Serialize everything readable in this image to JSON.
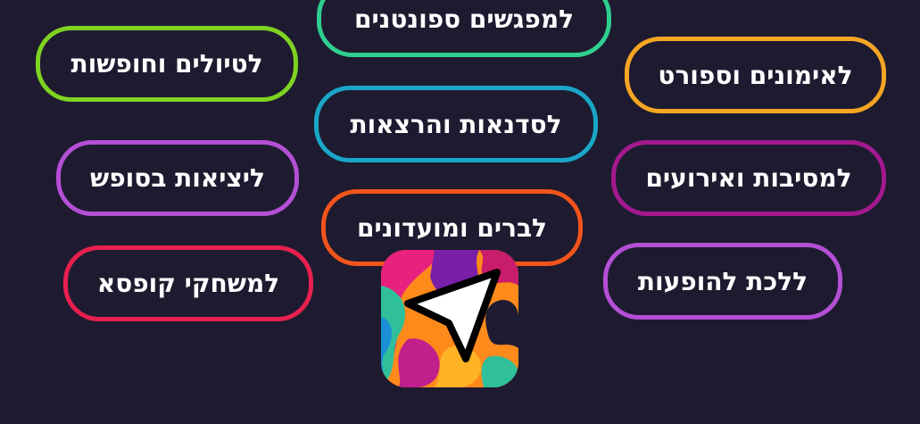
{
  "pills": [
    {
      "label": "למפגשים ספונטנים",
      "color": "#2ecf8f"
    },
    {
      "label": "לטיולים וחופשות",
      "color": "#7ed321"
    },
    {
      "label": "לאימונים וספורט",
      "color": "#f5a623"
    },
    {
      "label": "לסדנאות והרצאות",
      "color": "#1aa6c8"
    },
    {
      "label": "ליציאות בסופש",
      "color": "#b44fd6"
    },
    {
      "label": "למסיבות ואירועים",
      "color": "#a3198f"
    },
    {
      "label": "לברים ומועדונים",
      "color": "#f2541b"
    },
    {
      "label": "למשחקי קופסא",
      "color": "#e8204f"
    },
    {
      "label": "ללכת להופעות",
      "color": "#b44fd6"
    }
  ],
  "app_icon": {
    "icon": "navigation-arrow-icon"
  }
}
